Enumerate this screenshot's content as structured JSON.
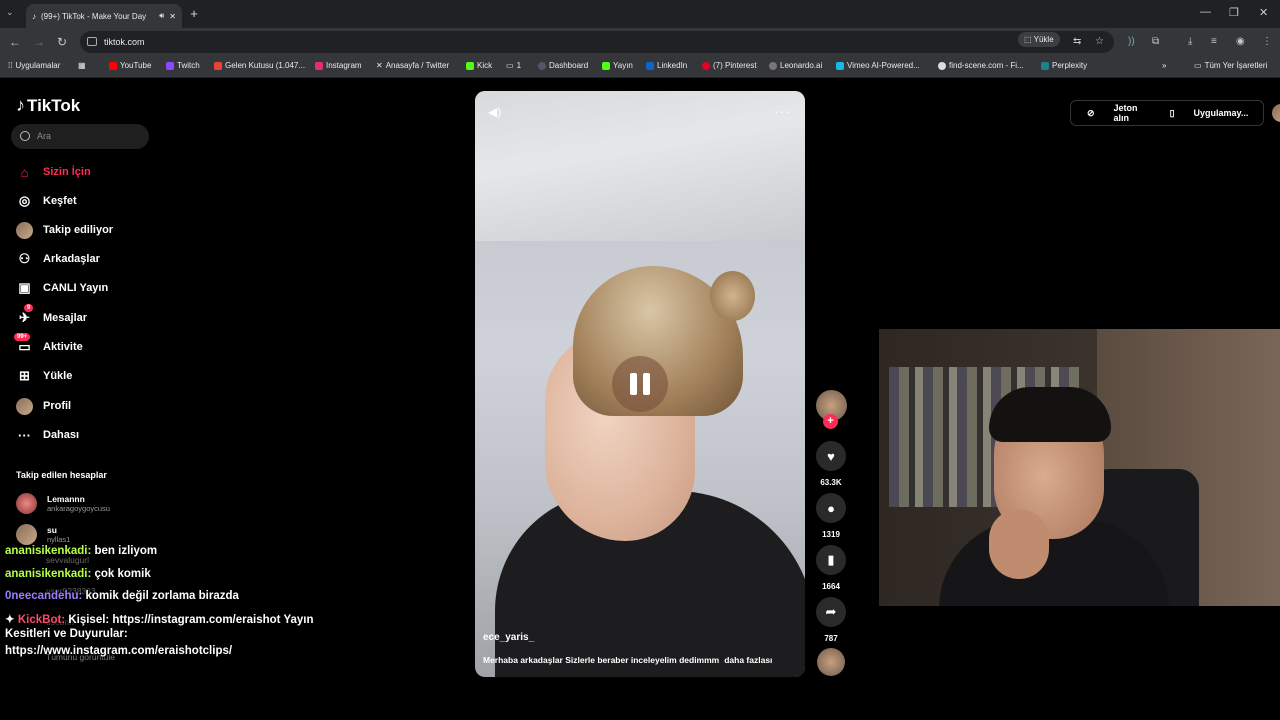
{
  "browser": {
    "tab_title": "(99+) TikTok - Make Your Day",
    "url": "tiktok.com",
    "install_label": "Yükle",
    "bookmarks": [
      "Uygulamalar",
      "YouTube",
      "Twitch",
      "Gelen Kutusu (1.047...",
      "Instagram",
      "Anasayfa / Twitter",
      "Kick",
      "1",
      "Dashboard",
      "Yayın",
      "LinkedIn",
      "(7) Pinterest",
      "Leonardo.ai",
      "Vimeo AI-Powered...",
      "find-scene.com - Fi...",
      "Perplexity"
    ],
    "all_bookmarks": "Tüm Yer İşaretleri"
  },
  "tiktok": {
    "logo": "TikTok",
    "search_placeholder": "Ara",
    "nav": [
      "Sizin İçin",
      "Keşfet",
      "Takip ediliyor",
      "Arkadaşlar",
      "CANLI Yayın",
      "Mesajlar",
      "Aktivite",
      "Yükle",
      "Profil",
      "Dahası"
    ],
    "messages_badge": "9",
    "activity_badge": "99+",
    "following_header": "Takip edilen hesaplar",
    "following": [
      {
        "name": "Lemannn",
        "user": "ankaragoygoycusu"
      },
      {
        "name": "su",
        "user": "nyllas1"
      },
      {
        "name": "sevvalugurl",
        "user": "sevvalugurl"
      },
      {
        "name": "user9238363",
        "user": "user9238363"
      },
      {
        "name": "dsebnn",
        "user": "dsebnn"
      }
    ],
    "see_all": "Tümünü görüntüle",
    "coins": "Jeton alın",
    "app": "Uygulamay...",
    "video": {
      "username": "ece_yaris_",
      "description": "Merhaba arkadaşlar Sizlerle beraber inceleyelim dedimmm",
      "more": "daha fazlası",
      "likes": "63.3K",
      "comments": "1319",
      "saves": "1664",
      "shares": "787"
    }
  },
  "chat": [
    {
      "user": "ananisikenkadi:",
      "msg": "ben izliyom"
    },
    {
      "user": "ananisikenkadi:",
      "msg": "çok komik"
    },
    {
      "user": "0neecandehu:",
      "msg": "komik değil zorlama birazda"
    },
    {
      "user": "KickBot:",
      "msg": "Kişisel: https://instagram.com/eraishot Yayın"
    },
    {
      "line": "Kesitleri ve Duyurular:"
    },
    {
      "line": "https://www.instagram.com/eraishotclips/"
    }
  ]
}
